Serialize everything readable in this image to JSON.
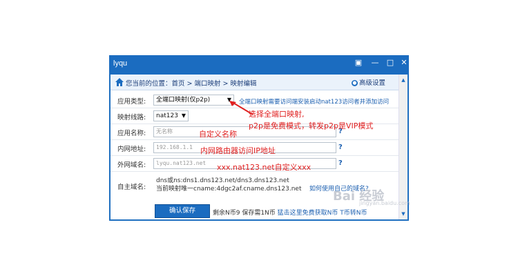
{
  "window": {
    "title": "lyqu",
    "buttons": {
      "menu": "▣",
      "minimize": "—",
      "maximize": "□",
      "close": "✕"
    }
  },
  "breadcrumb": {
    "text": "您当前的位置：首页 > 端口映射 > 映射编辑",
    "advanced": "高级设置"
  },
  "form": {
    "app_type": {
      "label": "应用类型:",
      "value": "全端口映射(仅p2p)",
      "note": "全端口映射需要访问端安装启动nat123访问者并添加访问"
    },
    "line": {
      "label": "映射线路:",
      "value": "nat123"
    },
    "app_name": {
      "label": "应用名称:",
      "placeholder": "无名称",
      "annotation": "自定义名称"
    },
    "lan_addr": {
      "label": "内网地址:",
      "value": "192.168.1.1",
      "annotation": "内网路由器访问IP地址"
    },
    "wan_domain": {
      "label": "外网域名:",
      "value": "lyqu.nat123.net",
      "annotation": "xxx.nat123.net自定义xxx"
    },
    "own_domain": {
      "label": "自主域名:",
      "line1": "dns或ns:dns1.dns123.net/dns3.dns123.net",
      "line2": "当前映射唯一cname:4dgc2af.cname.dns123.net",
      "help_link": "如何使用自己的域名?"
    },
    "qmark": "?"
  },
  "annotations": {
    "select_line1": "选择全端口映射,",
    "select_line2": "p2p是免费模式，转发p2p是VIP模式"
  },
  "footer": {
    "save": "确认保存",
    "remaining": "剩余N币9 保存需1N币",
    "free_link": "猛击这里免费获取N币",
    "transfer_link": "T币转N币"
  },
  "watermark": {
    "logo": "Bai 经验",
    "url": "jingyan.baidu.com"
  },
  "colors": {
    "titlebar": "#1b6cc0",
    "annotation": "#e02020",
    "link": "#1b5fb0"
  }
}
